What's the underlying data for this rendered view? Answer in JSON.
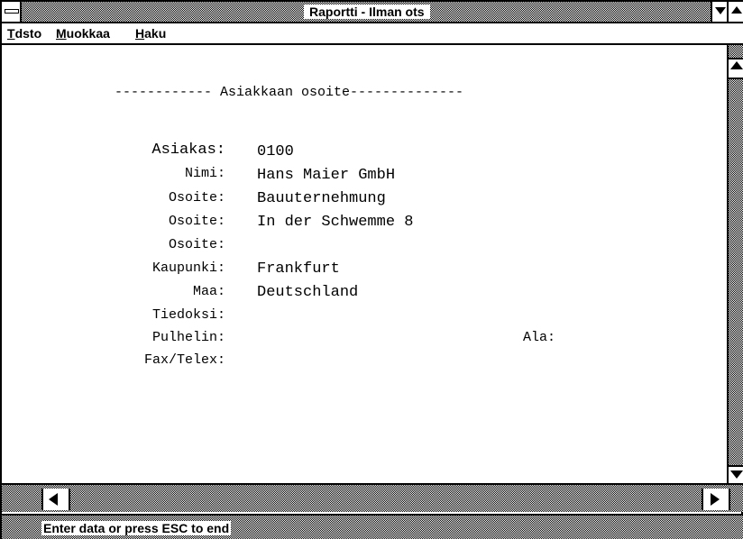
{
  "window": {
    "title": "Raportti - Ilman ots"
  },
  "menu": {
    "items": [
      {
        "underline": "T",
        "rest": "dsto"
      },
      {
        "underline": "M",
        "rest": "uokkaa"
      },
      {
        "underline": "H",
        "rest": "aku"
      }
    ]
  },
  "form": {
    "heading": "------------ Asiakkaan osoite--------------",
    "fields": [
      {
        "label": "Asiakas:",
        "value": "0100"
      },
      {
        "label": "Nimi:",
        "value": "Hans Maier GmbH"
      },
      {
        "label": "Osoite:",
        "value": "Bauuternehmung"
      },
      {
        "label": "Osoite:",
        "value": "In der Schwemme 8"
      },
      {
        "label": "Osoite:",
        "value": ""
      },
      {
        "label": "Kaupunki:",
        "value": "Frankfurt"
      },
      {
        "label": "Maa:",
        "value": "Deutschland"
      },
      {
        "label": "Tiedoksi:",
        "value": ""
      },
      {
        "label": "Pulhelin:",
        "value": ""
      },
      {
        "label": "Fax/Telex:",
        "value": ""
      }
    ],
    "ala_label": "Ala:"
  },
  "status": {
    "text": "Enter data or press ESC to end"
  }
}
